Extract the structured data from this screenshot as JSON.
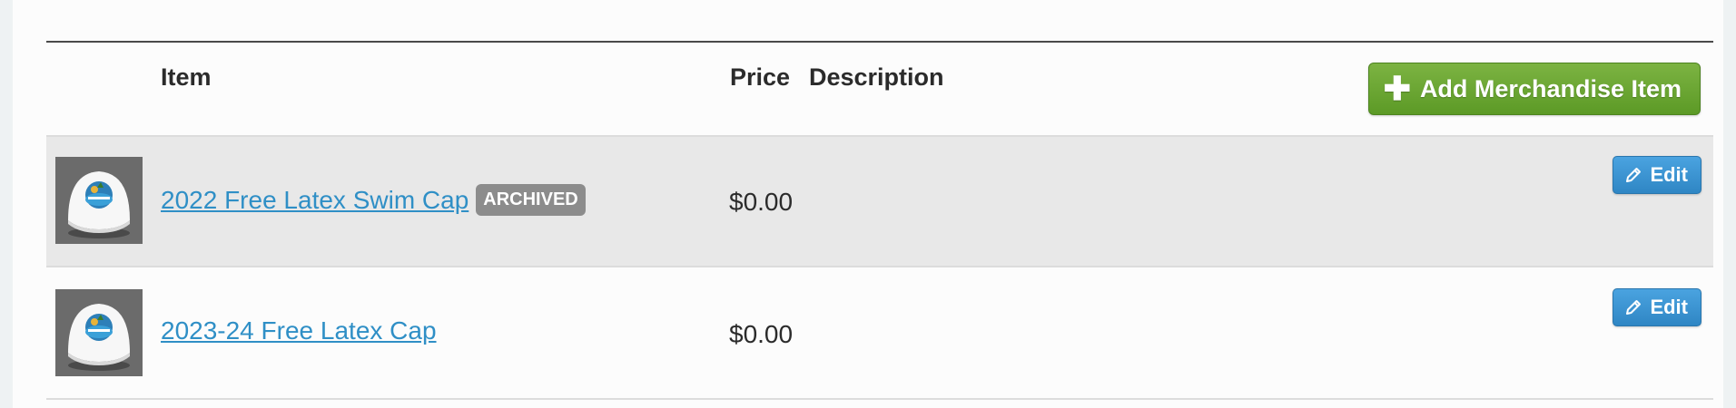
{
  "table": {
    "headers": {
      "item": "Item",
      "price": "Price",
      "description": "Description"
    },
    "add_button_label": "Add Merchandise Item"
  },
  "rows": [
    {
      "name": "2022 Free Latex Swim Cap",
      "badge": "ARCHIVED",
      "price": "$0.00",
      "description": "",
      "edit_label": "Edit",
      "archived": true
    },
    {
      "name": "2023-24 Free Latex Cap",
      "badge": "",
      "price": "$0.00",
      "description": "",
      "edit_label": "Edit",
      "archived": false
    }
  ],
  "colors": {
    "link": "#2f8fc6",
    "add_button": "#6aa532",
    "edit_button": "#3a93d2",
    "badge": "#8c8c8c",
    "archived_row": "#e8e8e8"
  },
  "icons": {
    "add": "plus-icon",
    "edit": "pencil-icon",
    "thumbnail": "swim-cap-image"
  }
}
